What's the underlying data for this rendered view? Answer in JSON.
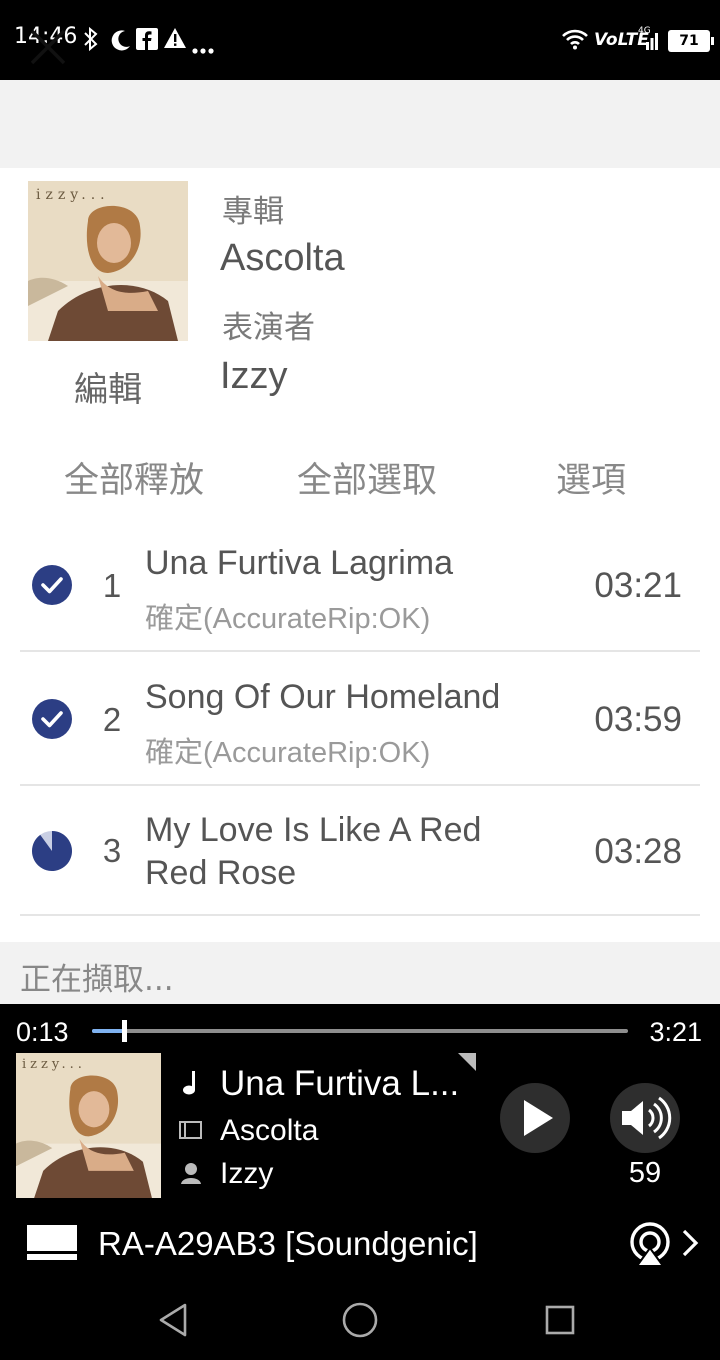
{
  "status_bar": {
    "time": "14:46",
    "left_icons": [
      "bluetooth-icon",
      "moon-icon",
      "facebook-icon",
      "warning-icon",
      "more-dots-icon"
    ],
    "right_icons": [
      "wifi-icon",
      "volte-icon",
      "signal-icon"
    ],
    "volte_label": "VoLTE",
    "network_label": "4G",
    "battery": "71"
  },
  "top_bar": {
    "close_icon": "close-icon"
  },
  "album": {
    "edit_label": "編輯",
    "album_label": "專輯",
    "album_value": "Ascolta",
    "artist_label": "表演者",
    "artist_value": "Izzy",
    "cover_text": "izzy..."
  },
  "actions": {
    "play_all": "全部釋放",
    "select_all": "全部選取",
    "options": "選項"
  },
  "tracks": [
    {
      "no": "1",
      "title_line1": "Una Furtiva Lagrima",
      "title_line2": "",
      "status": "確定(AccurateRip:OK)",
      "duration": "03:21",
      "state": "done"
    },
    {
      "no": "2",
      "title_line1": "Song Of Our Homeland",
      "title_line2": "",
      "status": "確定(AccurateRip:OK)",
      "duration": "03:59",
      "state": "done"
    },
    {
      "no": "3",
      "title_line1": "My Love Is Like A Red",
      "title_line2": "Red Rose",
      "status": "",
      "duration": "03:28",
      "state": "ripping",
      "rip_progress": 0.9
    }
  ],
  "ripping_text": "正在擷取...",
  "player": {
    "elapsed": "0:13",
    "total": "3:21",
    "progress": 0.06,
    "title": "Una Furtiva L...",
    "album": "Ascolta",
    "artist": "Izzy",
    "volume": "59",
    "device": "RA-A29AB3 [Soundgenic]",
    "accent": "#7fb2f0"
  },
  "colors": {
    "check_blue": "#2c3e84"
  }
}
